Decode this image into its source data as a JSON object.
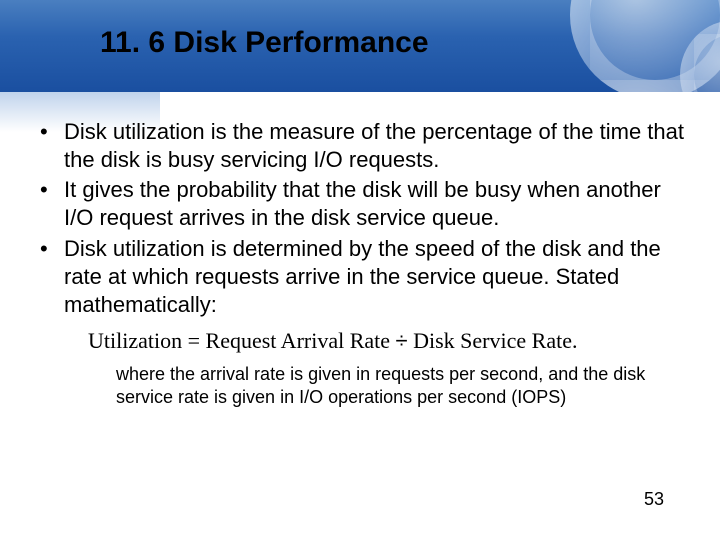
{
  "slide": {
    "title": "11. 6 Disk Performance",
    "bullets": [
      "Disk utilization is the measure of the percentage of the time that the disk is busy servicing I/O requests.",
      "It gives the probability that the disk will be busy when another I/O request arrives in the disk service queue.",
      "Disk utilization is determined by the speed of the disk and the rate at which requests arrive in the service queue.  Stated mathematically:"
    ],
    "formula": {
      "lhs": "Utilization",
      "eq": "=",
      "term1": "Request Arrival Rate",
      "op": "÷",
      "term2": "Disk Service Rate."
    },
    "note": "where the arrival rate is given in requests per second, and the disk service rate is given in I/O operations per second (IOPS)",
    "page_number": "53"
  }
}
